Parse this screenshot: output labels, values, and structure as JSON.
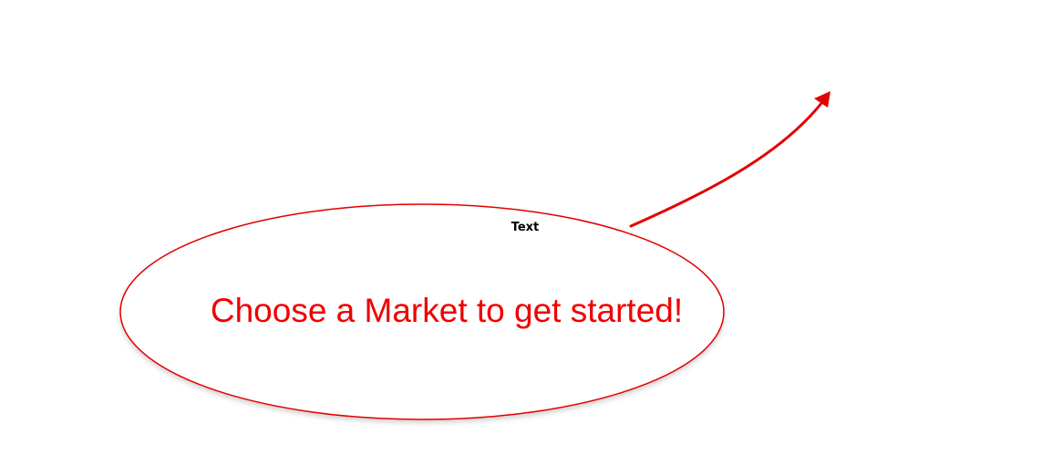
{
  "overlay": {
    "label": "Text",
    "message": "Choose a Market to get started!"
  },
  "icons": {
    "pointer": "arrow-up-right-icon",
    "callout": "ellipse-callout"
  },
  "colors": {
    "accent": "#e30000",
    "message": "#f00000",
    "label": "#000000",
    "background": "#ffffff"
  }
}
